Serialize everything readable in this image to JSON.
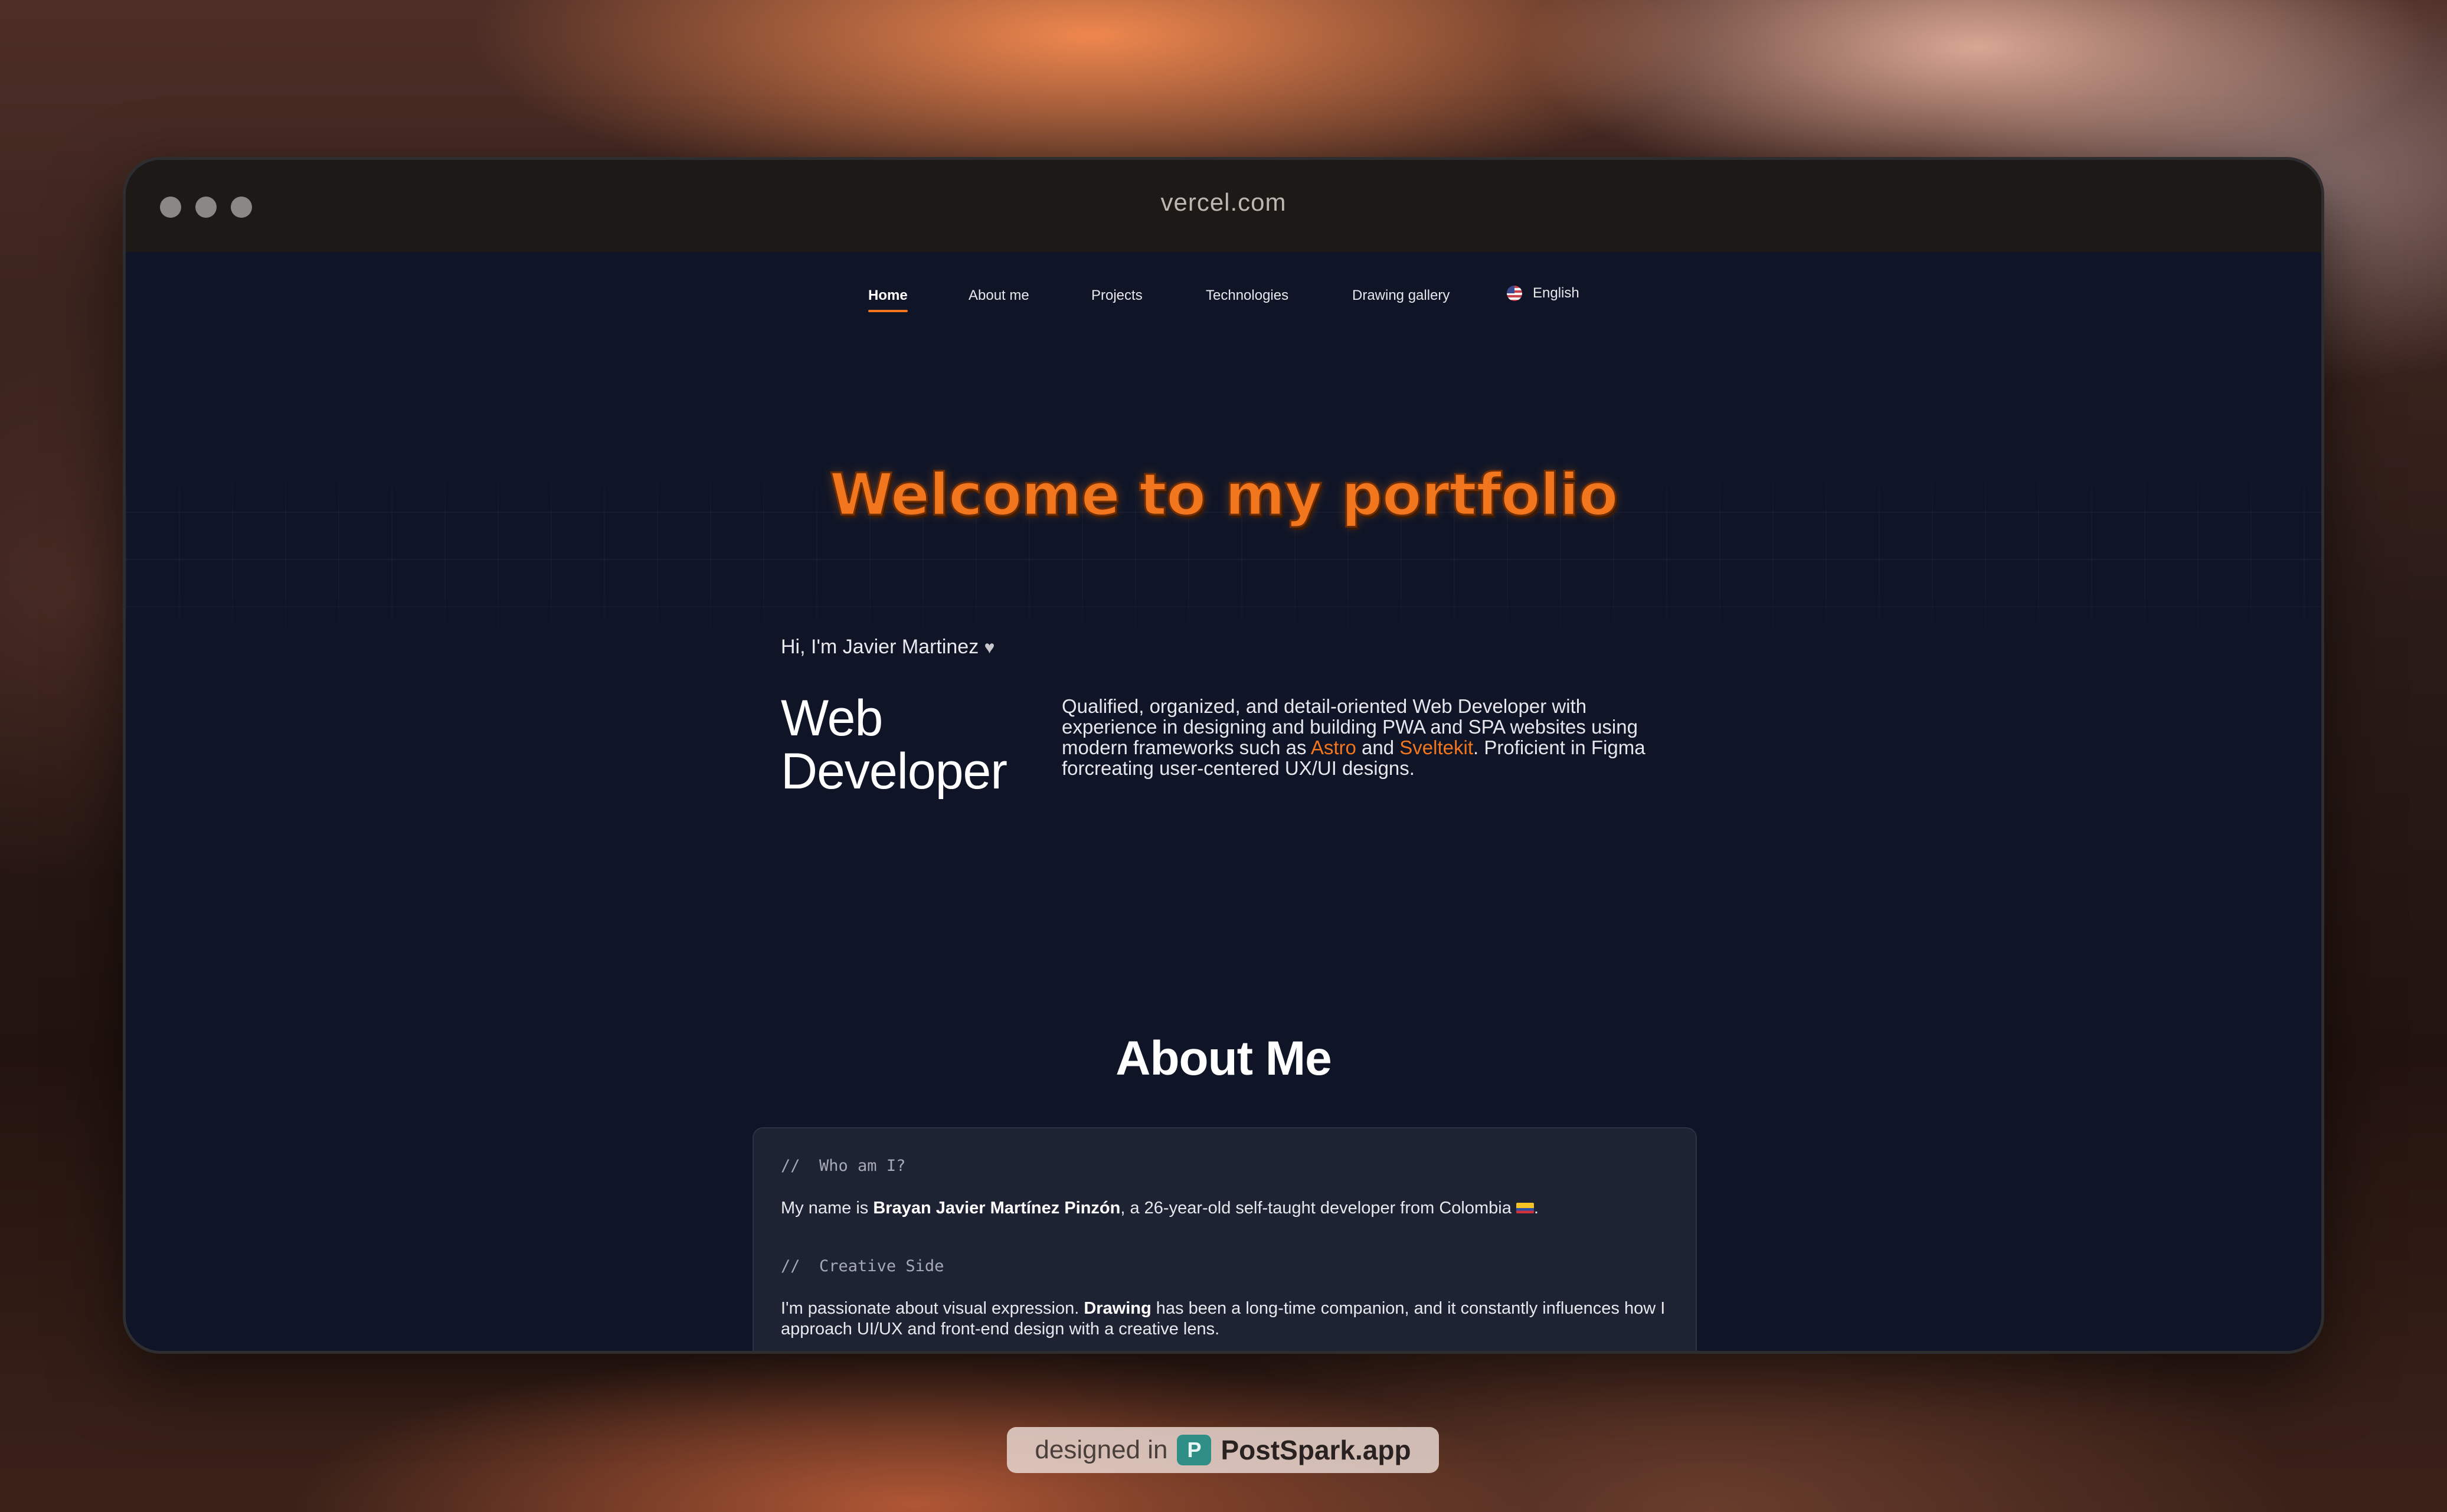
{
  "browser": {
    "url": "vercel.com"
  },
  "nav": {
    "items": [
      {
        "label": "Home",
        "active": true
      },
      {
        "label": "About me",
        "active": false
      },
      {
        "label": "Projects",
        "active": false
      },
      {
        "label": "Technologies",
        "active": false
      },
      {
        "label": "Drawing gallery",
        "active": false
      }
    ],
    "language": {
      "label": "English",
      "icon": "us-flag-icon"
    }
  },
  "hero": {
    "title": "Welcome to my portfolio",
    "greeting": "Hi, I'm Javier Martinez",
    "greeting_icon": "white-heart-icon",
    "role_line1": "Web",
    "role_line2": "Developer",
    "description": {
      "part1": "Qualified, organized, and detail-oriented Web Developer with experience in designing and building PWA and SPA websites using modern frameworks such as ",
      "framework1": "Astro",
      "and": " and ",
      "framework2": "Sveltekit",
      "part2": ". Proficient in Figma forcreating user-centered UX/UI designs."
    }
  },
  "about": {
    "title": "About Me",
    "comment_prefix": "//",
    "section1": {
      "comment": "Who am I?",
      "text_before": "My name is ",
      "name": "Brayan Javier Martínez Pinzón",
      "text_after": ", a 26-year-old self-taught developer from Colombia",
      "flag_icon": "colombia-flag-icon",
      "period": "."
    },
    "section2": {
      "comment": "Creative Side",
      "text_before": "I'm passionate about visual expression. ",
      "bold": "Drawing",
      "text_after": " has been a long-time companion, and it constantly influences how I approach UI/UX and front-end design with a creative lens."
    }
  },
  "footer_badge": {
    "prefix": "designed in",
    "brand": "PostSpark.app",
    "logo_letter": "P"
  },
  "colors": {
    "accent": "#f2761e",
    "page_background": "#0f1527",
    "titlebar": "#1c1916",
    "card": "#1d2333"
  }
}
